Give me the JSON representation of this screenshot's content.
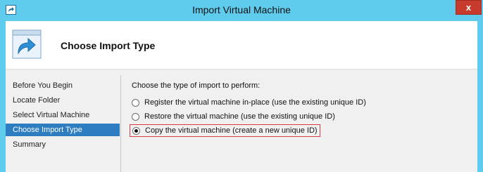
{
  "window": {
    "title": "Import Virtual Machine",
    "close_label": "x"
  },
  "header": {
    "title": "Choose Import Type"
  },
  "sidebar": {
    "items": [
      {
        "label": "Before You Begin"
      },
      {
        "label": "Locate Folder"
      },
      {
        "label": "Select Virtual Machine"
      },
      {
        "label": "Choose Import Type"
      },
      {
        "label": "Summary"
      }
    ]
  },
  "main": {
    "prompt": "Choose the type of import to perform:",
    "options": [
      {
        "label": "Register the virtual machine in-place (use the existing unique ID)",
        "checked": false
      },
      {
        "label": "Restore the virtual machine (use the existing unique ID)",
        "checked": false
      },
      {
        "label": "Copy the virtual machine (create a new unique ID)",
        "checked": true
      }
    ]
  }
}
